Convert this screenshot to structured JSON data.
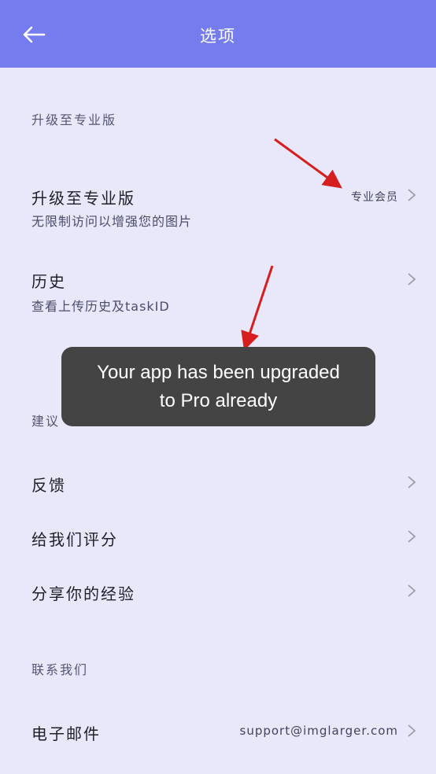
{
  "topbar": {
    "title": "选项"
  },
  "sections": {
    "upgrade_header": "升级至专业版",
    "suggest_header": "建议",
    "contact_header": "联系我们"
  },
  "rows": {
    "upgrade": {
      "title": "升级至专业版",
      "subtitle": "无限制访问以增强您的图片",
      "value": "专业会员"
    },
    "history": {
      "title": "历史",
      "subtitle": "查看上传历史及taskID"
    },
    "feedback": {
      "title": "反馈"
    },
    "rate": {
      "title": "给我们评分"
    },
    "share": {
      "title": "分享你的经验"
    },
    "email": {
      "title": "电子邮件",
      "value": "support@imglarger.com"
    }
  },
  "toast": {
    "line1": "Your app has been upgraded",
    "line2": "to Pro already"
  },
  "colors": {
    "topbar": "#757cee",
    "background": "#e8e8fa",
    "toast": "#444444",
    "annotation_arrow": "#d61e1e"
  },
  "icons": {
    "back": "arrow-left-icon",
    "chevron": "chevron-right-icon"
  }
}
